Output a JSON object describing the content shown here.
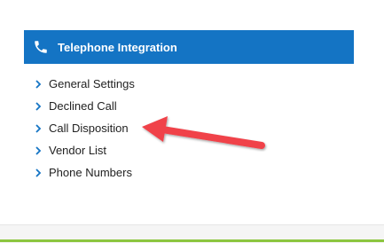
{
  "panel": {
    "title": "Telephone Integration",
    "icon": "phone-icon",
    "header_color": "#1474c4"
  },
  "menu": {
    "items": [
      {
        "label": "General Settings",
        "icon": "chevron-right-icon"
      },
      {
        "label": "Declined Call",
        "icon": "chevron-right-icon"
      },
      {
        "label": "Call Disposition",
        "icon": "chevron-right-icon"
      },
      {
        "label": "Vendor List",
        "icon": "chevron-right-icon"
      },
      {
        "label": "Phone Numbers",
        "icon": "chevron-right-icon"
      }
    ]
  },
  "annotation": {
    "icon": "arrow-pointer-icon",
    "color": "#f0424a"
  },
  "colors": {
    "bottom_accent": "#8cc63f"
  }
}
